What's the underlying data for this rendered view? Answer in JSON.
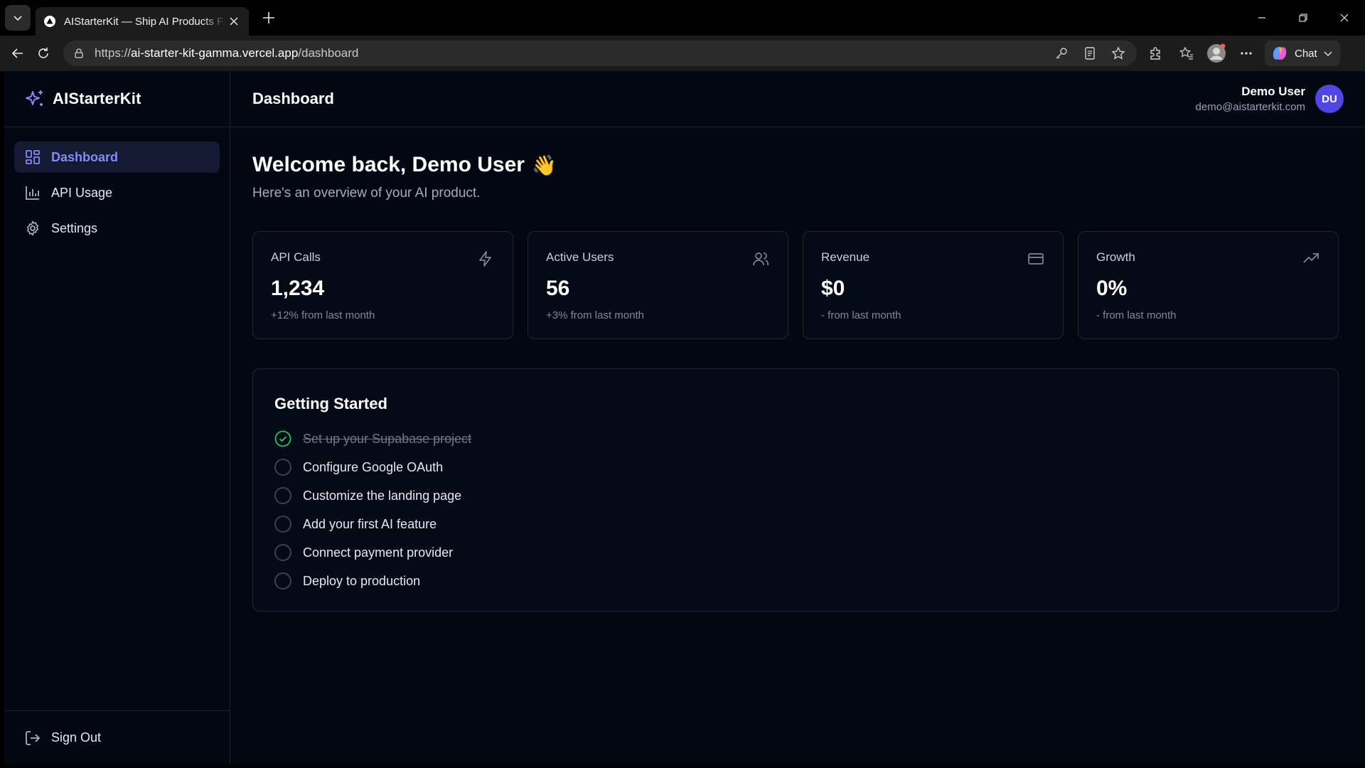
{
  "browser": {
    "tab_title": "AIStarterKit — Ship AI Products Fast",
    "url_prefix": "https://",
    "url_host": "ai-starter-kit-gamma.vercel.app",
    "url_path": "/dashboard",
    "chat_label": "Chat"
  },
  "brand": {
    "name": "AIStarterKit",
    "accent": "#818cf8"
  },
  "sidebar": {
    "items": [
      {
        "label": "Dashboard",
        "icon": "layout-grid-icon",
        "active": true
      },
      {
        "label": "API Usage",
        "icon": "bar-chart-icon",
        "active": false
      },
      {
        "label": "Settings",
        "icon": "gear-icon",
        "active": false
      }
    ],
    "sign_out": "Sign Out"
  },
  "header": {
    "title": "Dashboard",
    "user_name": "Demo User",
    "user_email": "demo@aistarterkit.com",
    "avatar_initials": "DU"
  },
  "welcome": {
    "title": "Welcome back, Demo User",
    "emoji": "👋",
    "subtitle": "Here's an overview of your AI product."
  },
  "stats": [
    {
      "label": "API Calls",
      "value": "1,234",
      "change": "+12% from last month",
      "icon": "zap-icon"
    },
    {
      "label": "Active Users",
      "value": "56",
      "change": "+3% from last month",
      "icon": "users-icon"
    },
    {
      "label": "Revenue",
      "value": "$0",
      "change": "- from last month",
      "icon": "credit-card-icon"
    },
    {
      "label": "Growth",
      "value": "0%",
      "change": "- from last month",
      "icon": "trending-up-icon"
    }
  ],
  "getting_started": {
    "title": "Getting Started",
    "tasks": [
      {
        "label": "Set up your Supabase project",
        "done": true
      },
      {
        "label": "Configure Google OAuth",
        "done": false
      },
      {
        "label": "Customize the landing page",
        "done": false
      },
      {
        "label": "Add your first AI feature",
        "done": false
      },
      {
        "label": "Connect payment provider",
        "done": false
      },
      {
        "label": "Deploy to production",
        "done": false
      }
    ]
  },
  "colors": {
    "app_bg": "#030711",
    "active_nav_bg": "#151a33",
    "avatar_bg": "#4f46e5",
    "success": "#22c55e"
  }
}
